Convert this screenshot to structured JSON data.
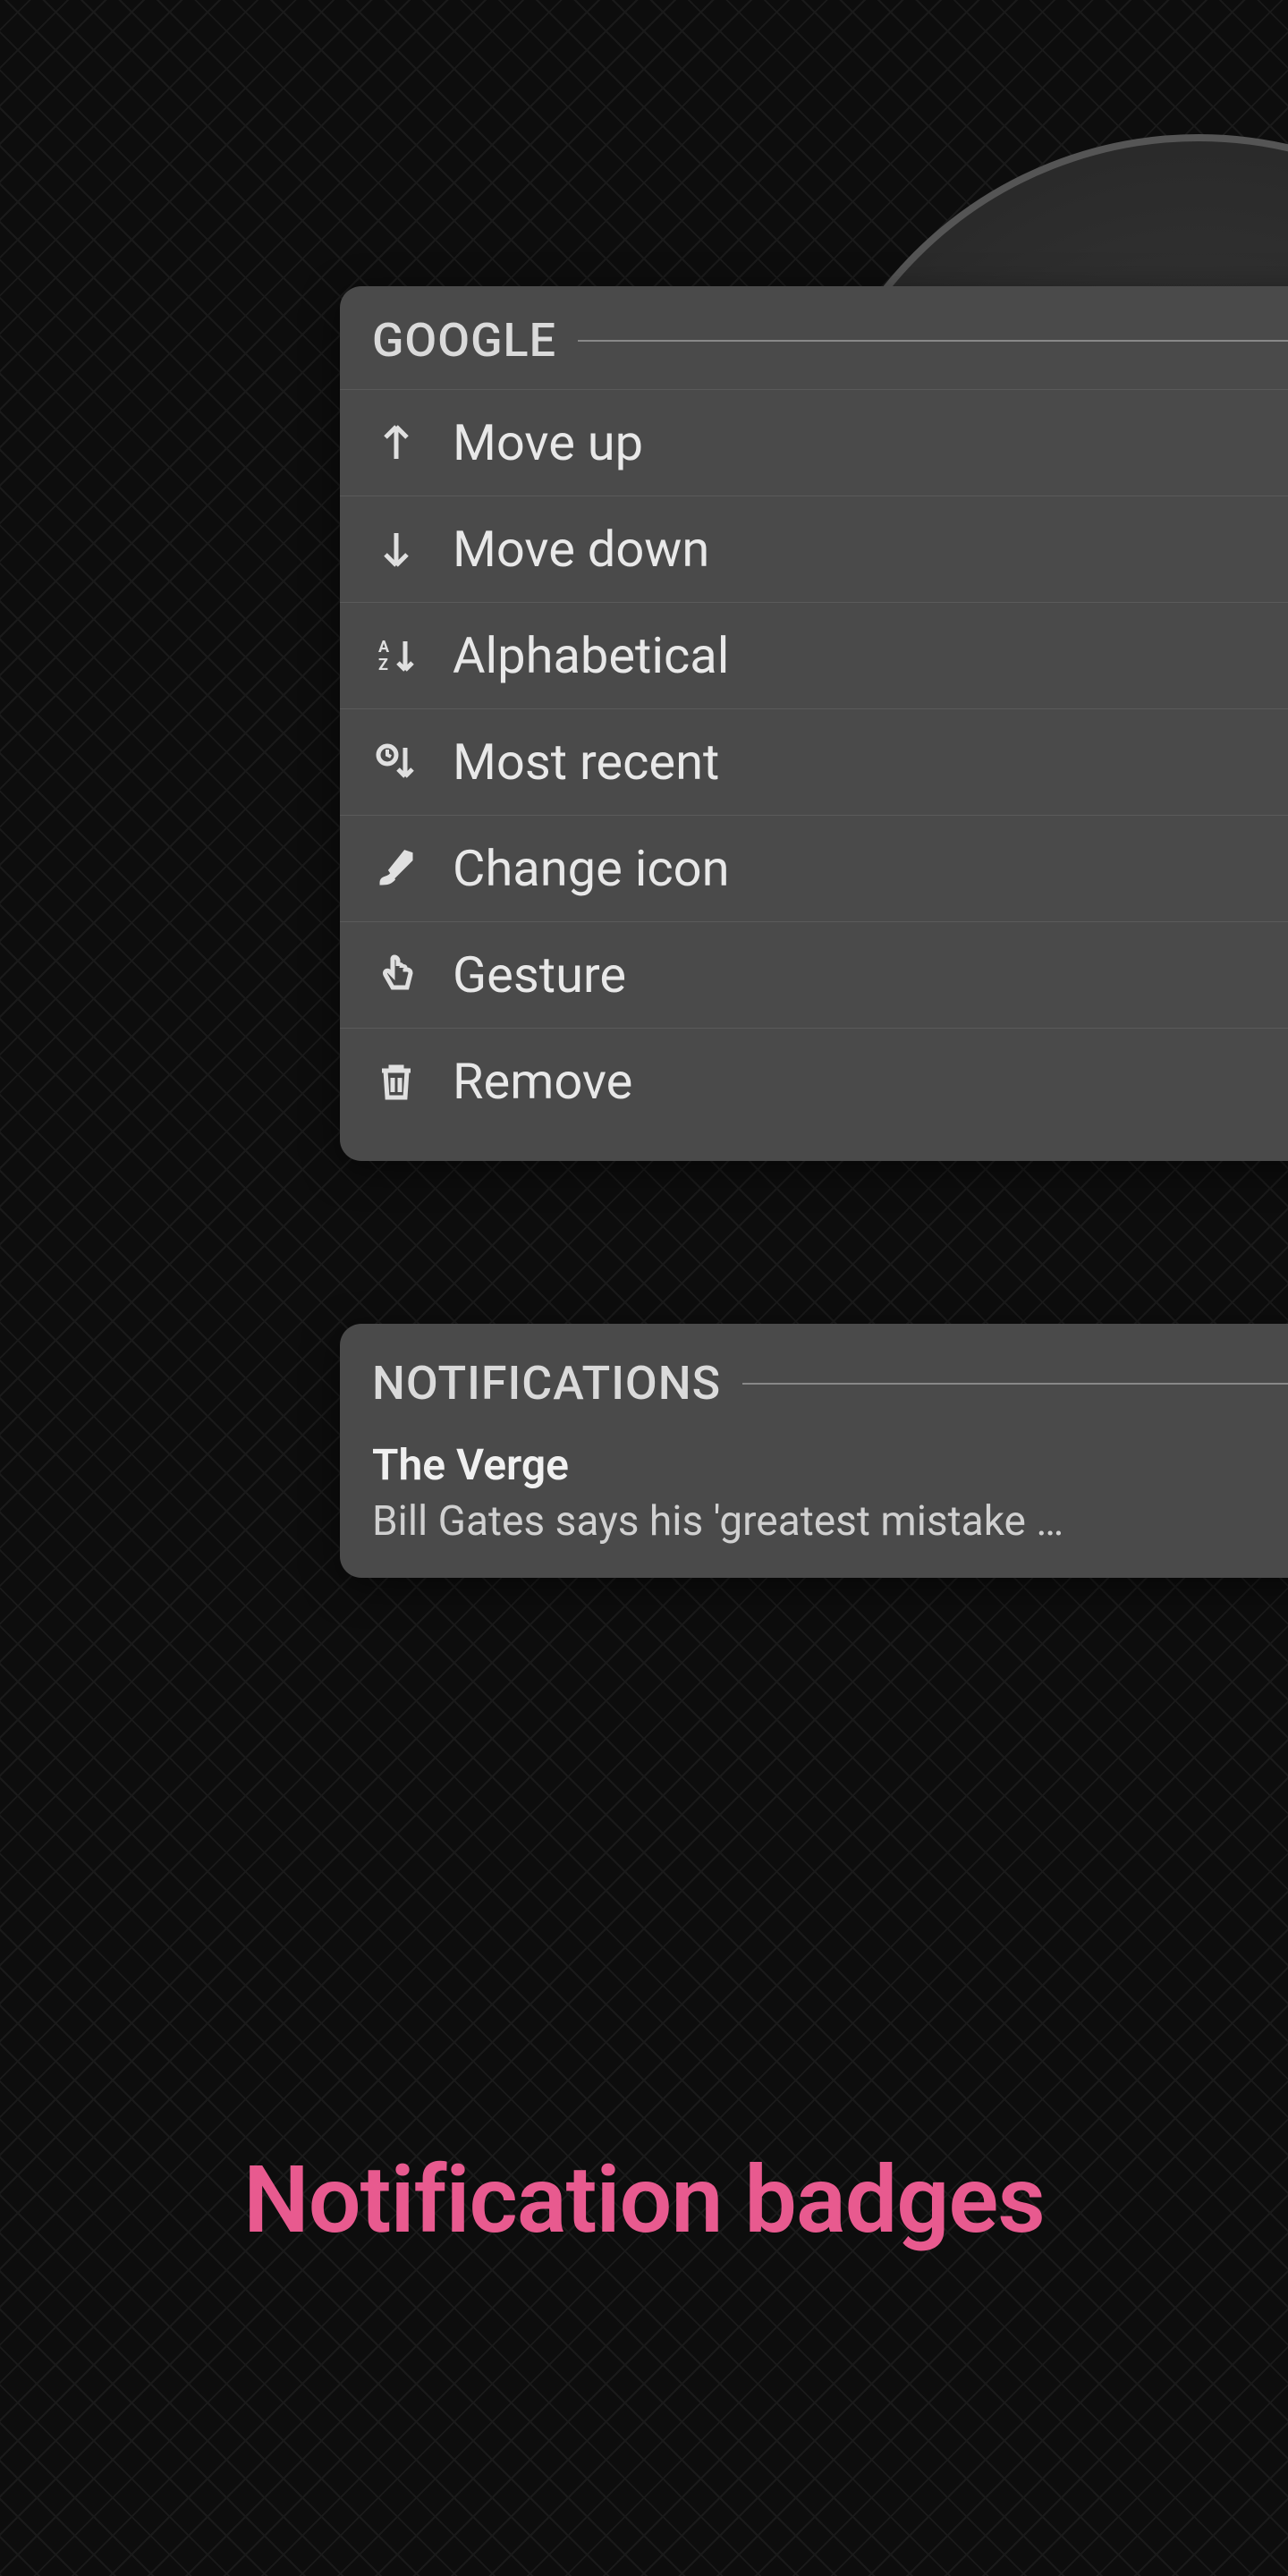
{
  "menu": {
    "title": "GOOGLE",
    "items": [
      {
        "label": "Move up",
        "icon": "arrow-up"
      },
      {
        "label": "Move down",
        "icon": "arrow-down"
      },
      {
        "label": "Alphabetical",
        "icon": "sort-az"
      },
      {
        "label": "Most recent",
        "icon": "sort-recent"
      },
      {
        "label": "Change icon",
        "icon": "brush"
      },
      {
        "label": "Gesture",
        "icon": "hand"
      },
      {
        "label": "Remove",
        "icon": "trash"
      }
    ]
  },
  "notifications": {
    "title": "NOTIFICATIONS",
    "items": [
      {
        "title": "The Verge",
        "body": "Bill Gates says his 'greatest mistake …"
      }
    ]
  },
  "caption": "Notification badges",
  "colors": {
    "panel_bg": "#4a4a4a",
    "text_primary": "#e8e8e8",
    "text_secondary": "#d0d0d0",
    "accent": "#e85a8f"
  }
}
